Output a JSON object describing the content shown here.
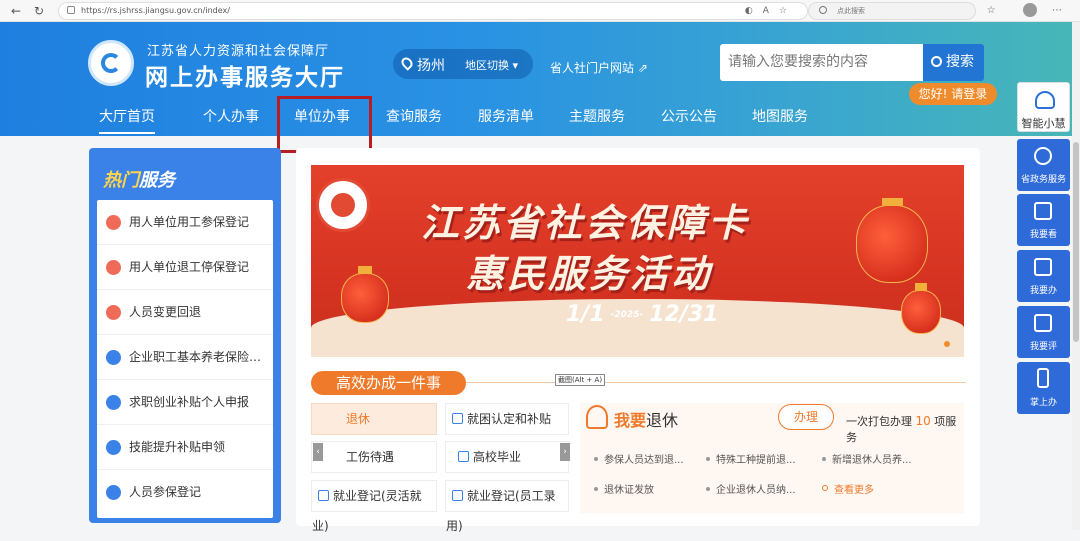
{
  "browser": {
    "url": "https://rs.jshrss.jiangsu.gov.cn/index/",
    "search_placeholder": "点此搜索"
  },
  "header": {
    "org_name": "江苏省人力资源和社会保障厅",
    "hall_name": "网上办事服务大厅",
    "city": "扬州",
    "region_switch": "地区切换",
    "portal_link": "省人社门户网站",
    "search_placeholder": "请输入您要搜索的内容",
    "search_button": "搜索",
    "login_button": "您好! 请登录"
  },
  "menu": [
    "大厅首页",
    "个人办事",
    "单位办事",
    "查询服务",
    "服务清单",
    "主题服务",
    "公示公告",
    "地图服务"
  ],
  "hot_services": {
    "title_a": "热门",
    "title_b": "服务",
    "items": [
      "用人单位用工参保登记",
      "用人单位退工停保登记",
      "人员变更回退",
      "企业职工基本养老保险关系转移",
      "求职创业补贴个人申报",
      "技能提升补贴申领",
      "人员参保登记"
    ],
    "icon_colors": [
      "#ef6b57",
      "#ef6b57",
      "#ef6b57",
      "#3b82e8",
      "#3b82e8",
      "#3b82e8",
      "#3b82e8"
    ]
  },
  "banner": {
    "title_line1": "江苏省社会保障卡",
    "title_line2": "惠民服务活动",
    "date_start": "1/1",
    "date_year": "-2025-",
    "date_end": "12/31"
  },
  "tooltip": "截图(Alt + A)",
  "section": {
    "title": "高效办成一件事",
    "services": [
      "退休",
      "就困认定和补贴",
      "工伤待遇",
      "高校毕业",
      "就业登记(灵活就业)",
      "就业登记(员工录用)"
    ]
  },
  "retire": {
    "title_a": "我要",
    "title_b": "退休",
    "button": "办理",
    "package_prefix": "一次打包办理",
    "package_count": "10",
    "package_suffix": "项服务",
    "links": [
      "参保人员达到退...",
      "特殊工种提前退...",
      "新增退休人员养...",
      "退休证发放",
      "企业退休人员纳...",
      "查看更多"
    ]
  },
  "float_bar": {
    "assistant": "智能小慧",
    "items": [
      "省政务服务",
      "我要看",
      "我要办",
      "我要评",
      "掌上办"
    ]
  }
}
